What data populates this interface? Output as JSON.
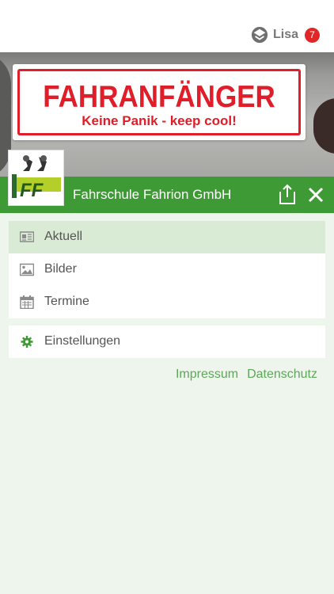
{
  "user": {
    "name": "Lisa",
    "notification_count": "7"
  },
  "hero": {
    "sticker_line1": "FAHRANFÄNGER",
    "sticker_line2": "Keine Panik - keep cool!"
  },
  "logo": {
    "text": "FF"
  },
  "header": {
    "title": "Fahrschule Fahrion GmbH"
  },
  "menu_main": [
    {
      "label": "Aktuell",
      "icon": "news-icon",
      "active": true
    },
    {
      "label": "Bilder",
      "icon": "image-icon",
      "active": false
    },
    {
      "label": "Termine",
      "icon": "calendar-icon",
      "active": false
    }
  ],
  "menu_settings": {
    "label": "Einstellungen",
    "icon": "gear-icon"
  },
  "footer": {
    "impressum": "Impressum",
    "datenschutz": "Datenschutz"
  },
  "colors": {
    "brand_green": "#3e9a34",
    "active_item": "#d9ebd5",
    "link_green": "#5da65a",
    "badge_red": "#e02626",
    "sticker_red": "#e01e2a"
  }
}
